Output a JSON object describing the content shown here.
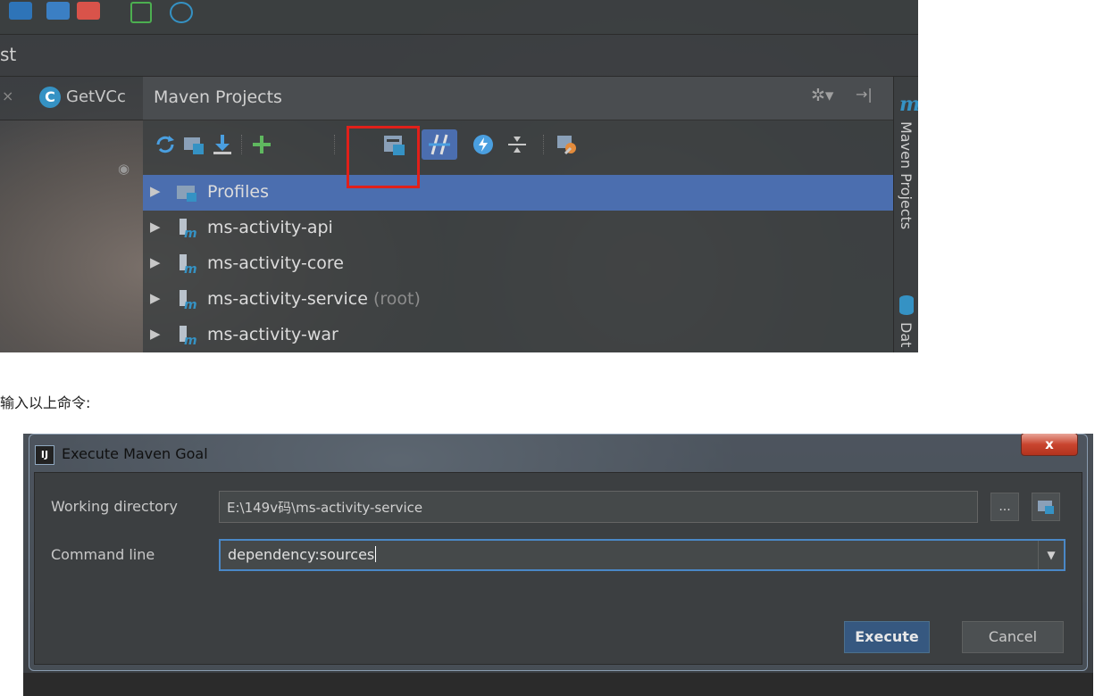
{
  "screenshot1": {
    "breadcrumb": "st",
    "left_tab_label": "GetVCc",
    "maven_panel": {
      "title": "Maven Projects",
      "side_label": "Maven Projects",
      "side_label2": "Dat",
      "toolbar_icons": [
        "reimport-icon",
        "generate-sources-icon",
        "download-icon",
        "add-icon",
        "execute-maven-goal-icon",
        "toggle-offline-icon",
        "skip-tests-icon",
        "collapse-all-icon",
        "settings-icon"
      ],
      "tree": [
        {
          "label": "Profiles",
          "suffix": "",
          "icon": "folder-icon",
          "selected": true
        },
        {
          "label": "ms-activity-api",
          "suffix": "",
          "icon": "maven-module-icon",
          "selected": false
        },
        {
          "label": "ms-activity-core",
          "suffix": "",
          "icon": "maven-module-icon",
          "selected": false
        },
        {
          "label": "ms-activity-service",
          "suffix": "(root)",
          "icon": "maven-module-icon",
          "selected": false
        },
        {
          "label": "ms-activity-war",
          "suffix": "",
          "icon": "maven-module-icon",
          "selected": false
        }
      ]
    }
  },
  "instruction": "输入以上命令:",
  "dialog": {
    "title": "Execute Maven Goal",
    "close_label": "x",
    "working_directory_label": "Working directory",
    "working_directory_value": "E:\\149v码\\ms-activity-service",
    "browse_label": "...",
    "command_line_label": "Command line",
    "command_line_value": "dependency:sources",
    "execute_label": "Execute",
    "cancel_label": "Cancel"
  }
}
